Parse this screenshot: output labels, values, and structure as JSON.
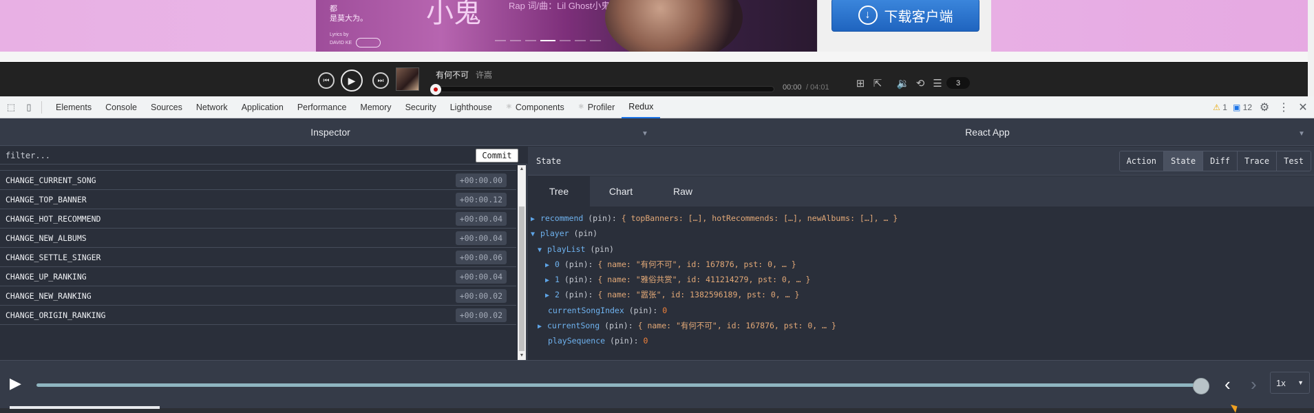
{
  "site": {
    "banner": {
      "lyric_lines": [
        "都",
        "是莫大为。"
      ],
      "lyrics_by": "Lyrics by",
      "lyricist": "DAVID KE",
      "big_title": "小鬼",
      "credits": "Rap 词/曲：Lil Ghost小鬼"
    },
    "download_label": "下载客户端",
    "player": {
      "song_title": "有何不可",
      "artist": "许嵩",
      "time_current": "00:00",
      "time_total": "/ 04:01",
      "list_count": "3"
    }
  },
  "devtools": {
    "tabs": [
      {
        "label": "Elements"
      },
      {
        "label": "Console"
      },
      {
        "label": "Sources"
      },
      {
        "label": "Network"
      },
      {
        "label": "Application"
      },
      {
        "label": "Performance"
      },
      {
        "label": "Memory"
      },
      {
        "label": "Security"
      },
      {
        "label": "Lighthouse"
      },
      {
        "label": "Components"
      },
      {
        "label": "Profiler"
      },
      {
        "label": "Redux"
      }
    ],
    "warn_count": "1",
    "msg_count": "12"
  },
  "redux": {
    "inspector_title": "Inspector",
    "app_title": "React App",
    "filter_placeholder": "filter...",
    "commit_label": "Commit",
    "actions": [
      {
        "name": "CHANGE_CURRENT_SONG",
        "time": "+00:00.00"
      },
      {
        "name": "CHANGE_TOP_BANNER",
        "time": "+00:00.12"
      },
      {
        "name": "CHANGE_HOT_RECOMMEND",
        "time": "+00:00.04"
      },
      {
        "name": "CHANGE_NEW_ALBUMS",
        "time": "+00:00.04"
      },
      {
        "name": "CHANGE_SETTLE_SINGER",
        "time": "+00:00.06"
      },
      {
        "name": "CHANGE_UP_RANKING",
        "time": "+00:00.04"
      },
      {
        "name": "CHANGE_NEW_RANKING",
        "time": "+00:00.02"
      },
      {
        "name": "CHANGE_ORIGIN_RANKING",
        "time": "+00:00.02"
      }
    ],
    "state_label": "State",
    "modes": [
      "Action",
      "State",
      "Diff",
      "Trace",
      "Test"
    ],
    "sub_tabs": [
      "Tree",
      "Chart",
      "Raw"
    ],
    "tree": {
      "recommend_key": "recommend",
      "recommend_val": "{ topBanners: […], hotRecommends: […], newAlbums: […], … }",
      "player_key": "player",
      "playlist_key": "playList",
      "item0_key": "0",
      "item0_val": "{ name: \"有何不可\", id: 167876, pst: 0, … }",
      "item1_key": "1",
      "item1_val": "{ name: \"雅俗共赏\", id: 411214279, pst: 0, … }",
      "item2_key": "2",
      "item2_val": "{ name: \"嚣张\", id: 1382596189, pst: 0, … }",
      "current_index_key": "currentSongIndex",
      "current_index_val": "0",
      "current_song_key": "currentSong",
      "current_song_val": "{ name: \"有何不可\", id: 167876, pst: 0, … }",
      "play_sequence_key": "playSequence",
      "play_sequence_val": "0",
      "pin_label": "(pin):",
      "pin_label_plain": "(pin)"
    },
    "speed": "1x"
  }
}
